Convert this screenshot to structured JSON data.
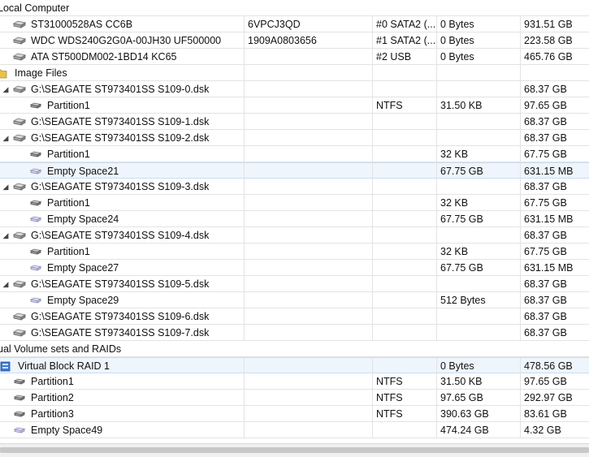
{
  "rows": [
    {
      "type": "section",
      "label": "Local Computer",
      "icon": "",
      "c1": "",
      "c2": "",
      "c3": "",
      "c4": ""
    },
    {
      "type": "disk",
      "label": "ST31000528AS CC6B",
      "icon": "hdd-icon",
      "c1": "6VPCJ3QD",
      "c2": "#0 SATA2 (...",
      "c3": "0 Bytes",
      "c4": "931.51 GB"
    },
    {
      "type": "disk",
      "label": "WDC WDS240G2G0A-00JH30 UF500000",
      "icon": "hdd-icon",
      "c1": "1909A0803656",
      "c2": "#1 SATA2 (...",
      "c3": "0 Bytes",
      "c4": "223.58 GB"
    },
    {
      "type": "disk",
      "label": "ATA ST500DM002-1BD14 KC65",
      "icon": "hdd-icon",
      "c1": "",
      "c2": "#2 USB",
      "c3": "0 Bytes",
      "c4": "465.76 GB"
    },
    {
      "type": "folder",
      "label": "Image Files",
      "icon": "folder-icon",
      "c1": "",
      "c2": "",
      "c3": "",
      "c4": ""
    },
    {
      "type": "image",
      "label": "G:\\SEAGATE ST973401SS S109-0.dsk",
      "icon": "disk-image-icon",
      "expander": "▲",
      "c1": "",
      "c2": "",
      "c3": "",
      "c4": "68.37 GB"
    },
    {
      "type": "partition",
      "label": "Partition1",
      "icon": "partition-icon",
      "c1": "",
      "c2": "NTFS",
      "c3": "31.50 KB",
      "c4": "97.65 GB"
    },
    {
      "type": "image",
      "label": "G:\\SEAGATE ST973401SS S109-1.dsk",
      "icon": "disk-image-icon",
      "expander": "",
      "c1": "",
      "c2": "",
      "c3": "",
      "c4": "68.37 GB"
    },
    {
      "type": "image",
      "label": "G:\\SEAGATE ST973401SS S109-2.dsk",
      "icon": "disk-image-icon",
      "expander": "▲",
      "c1": "",
      "c2": "",
      "c3": "",
      "c4": "68.37 GB"
    },
    {
      "type": "partition",
      "label": "Partition1",
      "icon": "partition-icon",
      "c1": "",
      "c2": "",
      "c3": "32 KB",
      "c4": "67.75 GB"
    },
    {
      "type": "empty",
      "label": "Empty Space21",
      "icon": "empty-space-icon",
      "selected": true,
      "c1": "",
      "c2": "",
      "c3": "67.75 GB",
      "c4": "631.15 MB"
    },
    {
      "type": "image",
      "label": "G:\\SEAGATE ST973401SS S109-3.dsk",
      "icon": "disk-image-icon",
      "expander": "▲",
      "c1": "",
      "c2": "",
      "c3": "",
      "c4": "68.37 GB"
    },
    {
      "type": "partition",
      "label": "Partition1",
      "icon": "partition-icon",
      "c1": "",
      "c2": "",
      "c3": "32 KB",
      "c4": "67.75 GB"
    },
    {
      "type": "empty",
      "label": "Empty Space24",
      "icon": "empty-space-icon",
      "c1": "",
      "c2": "",
      "c3": "67.75 GB",
      "c4": "631.15 MB"
    },
    {
      "type": "image",
      "label": "G:\\SEAGATE ST973401SS S109-4.dsk",
      "icon": "disk-image-icon",
      "expander": "▲",
      "c1": "",
      "c2": "",
      "c3": "",
      "c4": "68.37 GB"
    },
    {
      "type": "partition",
      "label": "Partition1",
      "icon": "partition-icon",
      "c1": "",
      "c2": "",
      "c3": "32 KB",
      "c4": "67.75 GB"
    },
    {
      "type": "empty",
      "label": "Empty Space27",
      "icon": "empty-space-icon",
      "c1": "",
      "c2": "",
      "c3": "67.75 GB",
      "c4": "631.15 MB"
    },
    {
      "type": "image",
      "label": "G:\\SEAGATE ST973401SS S109-5.dsk",
      "icon": "disk-image-icon",
      "expander": "▲",
      "c1": "",
      "c2": "",
      "c3": "",
      "c4": "68.37 GB"
    },
    {
      "type": "empty",
      "label": "Empty Space29",
      "icon": "empty-space-icon",
      "c1": "",
      "c2": "",
      "c3": "512 Bytes",
      "c4": "68.37 GB"
    },
    {
      "type": "image",
      "label": "G:\\SEAGATE ST973401SS S109-6.dsk",
      "icon": "disk-image-icon",
      "expander": "",
      "c1": "",
      "c2": "",
      "c3": "",
      "c4": "68.37 GB"
    },
    {
      "type": "image",
      "label": "G:\\SEAGATE ST973401SS S109-7.dsk",
      "icon": "disk-image-icon",
      "expander": "",
      "c1": "",
      "c2": "",
      "c3": "",
      "c4": "68.37 GB"
    },
    {
      "type": "section",
      "label": "ual Volume sets and RAIDs",
      "icon": "",
      "c1": "",
      "c2": "",
      "c3": "",
      "c4": ""
    },
    {
      "type": "raid",
      "label": "Virtual Block RAID 1",
      "icon": "raid-icon",
      "selected": true,
      "c1": "",
      "c2": "",
      "c3": "0 Bytes",
      "c4": "478.56 GB"
    },
    {
      "type": "partition",
      "label": "Partition1",
      "icon": "partition-icon",
      "c1": "",
      "c2": "NTFS",
      "c3": "31.50 KB",
      "c4": "97.65 GB"
    },
    {
      "type": "partition",
      "label": "Partition2",
      "icon": "partition-icon",
      "c1": "",
      "c2": "NTFS",
      "c3": "97.65 GB",
      "c4": "292.97 GB"
    },
    {
      "type": "partition",
      "label": "Partition3",
      "icon": "partition-icon",
      "c1": "",
      "c2": "NTFS",
      "c3": "390.63 GB",
      "c4": "83.61 GB"
    },
    {
      "type": "empty",
      "label": "Empty Space49",
      "icon": "empty-space-icon",
      "c1": "",
      "c2": "",
      "c3": "474.24 GB",
      "c4": "4.32 GB"
    }
  ],
  "colors": {
    "selection": "#eef5fc",
    "grid": "#e3e3e3",
    "raid_icon": "#3a7bd5",
    "folder_icon": "#e8c04a"
  }
}
